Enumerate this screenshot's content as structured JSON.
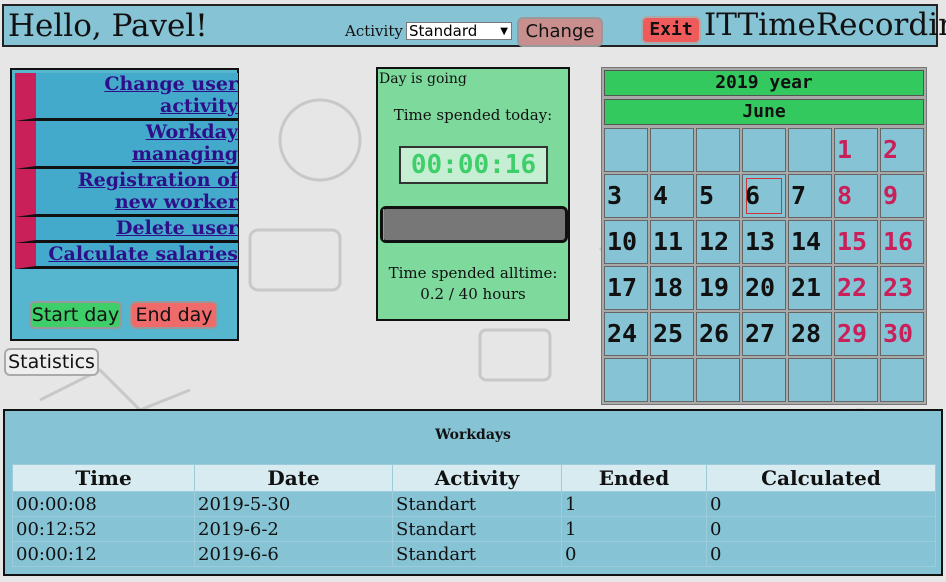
{
  "header": {
    "greeting": "Hello, Pavel!",
    "activity_label": "Activity",
    "activity_selected": "Standard",
    "change_label": "Change",
    "exit_label": "Exit",
    "app_name": "ITTimeRecording"
  },
  "menu": {
    "items": [
      {
        "line1": "Change user",
        "line2": "activity"
      },
      {
        "line1": "Workday",
        "line2": "managing"
      },
      {
        "line1": "Registration of",
        "line2": "new worker"
      },
      {
        "line1": "Delete user"
      },
      {
        "line1": "Calculate salaries"
      }
    ],
    "start_label": "Start day",
    "end_label": "End day",
    "statistics_label": "Statistics"
  },
  "day": {
    "status": "Day is going",
    "today_label": "Time spended today:",
    "timer": "00:00:16",
    "alltime_label": "Time spended alltime:",
    "alltime_value": "0.2 / 40 hours",
    "progress_fraction": 0.005
  },
  "calendar": {
    "year": "2019 year",
    "month": "June",
    "weeks": [
      [
        "",
        "",
        "",
        "",
        "",
        "1",
        "2"
      ],
      [
        "3",
        "4",
        "5",
        "6",
        "7",
        "8",
        "9"
      ],
      [
        "10",
        "11",
        "12",
        "13",
        "14",
        "15",
        "16"
      ],
      [
        "17",
        "18",
        "19",
        "20",
        "21",
        "22",
        "23"
      ],
      [
        "24",
        "25",
        "26",
        "27",
        "28",
        "29",
        "30"
      ],
      [
        "",
        "",
        "",
        "",
        "",
        "",
        ""
      ]
    ],
    "today": "6",
    "weekend_color": "#c9205a"
  },
  "workdays": {
    "title": "Workdays",
    "columns": [
      "Time",
      "Date",
      "Activity",
      "Ended",
      "Calculated"
    ],
    "rows": [
      [
        "00:00:08",
        "2019-5-30",
        "Standart",
        "1",
        "0"
      ],
      [
        "00:12:52",
        "2019-6-2",
        "Standart",
        "1",
        "0"
      ],
      [
        "00:00:12",
        "2019-6-6",
        "Standart",
        "0",
        "0"
      ]
    ]
  }
}
